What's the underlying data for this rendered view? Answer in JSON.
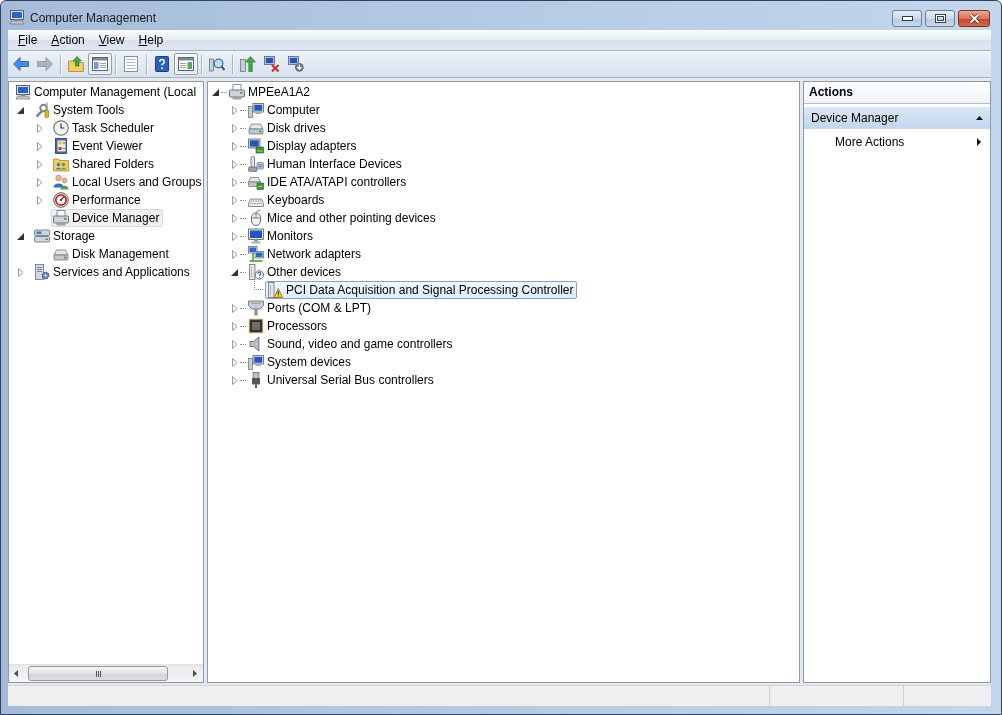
{
  "window": {
    "title": "Computer Management"
  },
  "menu_bar": [
    {
      "label": "File"
    },
    {
      "label": "Action"
    },
    {
      "label": "View"
    },
    {
      "label": "Help"
    }
  ],
  "toolbar": {
    "groups": [
      {
        "buttons": [
          {
            "pressed": false,
            "disabled": false
          },
          {
            "pressed": false,
            "disabled": true
          }
        ]
      },
      {
        "buttons": [
          {
            "pressed": false,
            "disabled": false
          },
          {
            "pressed": true,
            "disabled": false
          }
        ]
      },
      {
        "buttons": [
          {
            "pressed": false,
            "disabled": false
          }
        ]
      },
      {
        "buttons": [
          {
            "pressed": false,
            "disabled": false
          },
          {
            "pressed": true,
            "disabled": false
          }
        ]
      },
      {
        "buttons": [
          {
            "pressed": false,
            "disabled": false
          }
        ]
      },
      {
        "buttons": [
          {
            "pressed": false,
            "disabled": false
          },
          {
            "pressed": false,
            "disabled": false
          },
          {
            "pressed": false,
            "disabled": false
          }
        ]
      }
    ]
  },
  "console_tree": {
    "items": [
      {
        "label": "Computer Management (Local",
        "kind": "management",
        "expandable": false,
        "selected": false,
        "children": [
          {
            "label": "System Tools",
            "kind": "tools",
            "expandable": true,
            "expanded": true,
            "selected": false,
            "children": [
              {
                "label": "Task Scheduler",
                "kind": "clock",
                "expandable": true,
                "expanded": false,
                "selected": false
              },
              {
                "label": "Event Viewer",
                "kind": "log",
                "expandable": true,
                "expanded": false,
                "selected": false
              },
              {
                "label": "Shared Folders",
                "kind": "share",
                "expandable": true,
                "expanded": false,
                "selected": false
              },
              {
                "label": "Local Users and Groups",
                "kind": "users",
                "expandable": true,
                "expanded": false,
                "selected": false
              },
              {
                "label": "Performance",
                "kind": "performance",
                "expandable": true,
                "expanded": false,
                "selected": false
              },
              {
                "label": "Device Manager",
                "kind": "devices",
                "expandable": false,
                "selected": true
              }
            ]
          },
          {
            "label": "Storage",
            "kind": "storage",
            "expandable": true,
            "expanded": true,
            "selected": false,
            "children": [
              {
                "label": "Disk Management",
                "kind": "disk",
                "expandable": false,
                "selected": false
              }
            ]
          },
          {
            "label": "Services and Applications",
            "kind": "services",
            "expandable": true,
            "expanded": false,
            "selected": false
          }
        ]
      }
    ]
  },
  "device_tree": {
    "items": [
      {
        "label": "MPEeA1A2",
        "kind": "host",
        "expandable": true,
        "expanded": true,
        "selected": false,
        "children": [
          {
            "label": "Computer",
            "kind": "computer",
            "expandable": true,
            "expanded": false,
            "selected": false
          },
          {
            "label": "Disk drives",
            "kind": "disk",
            "expandable": true,
            "expanded": false,
            "selected": false
          },
          {
            "label": "Display adapters",
            "kind": "display",
            "expandable": true,
            "expanded": false,
            "selected": false
          },
          {
            "label": "Human Interface Devices",
            "kind": "hid",
            "expandable": true,
            "expanded": false,
            "selected": false
          },
          {
            "label": "IDE ATA/ATAPI controllers",
            "kind": "ide",
            "expandable": true,
            "expanded": false,
            "selected": false
          },
          {
            "label": "Keyboards",
            "kind": "keyboard",
            "expandable": true,
            "expanded": false,
            "selected": false
          },
          {
            "label": "Mice and other pointing devices",
            "kind": "mouse",
            "expandable": true,
            "expanded": false,
            "selected": false
          },
          {
            "label": "Monitors",
            "kind": "monitor",
            "expandable": true,
            "expanded": false,
            "selected": false
          },
          {
            "label": "Network adapters",
            "kind": "network",
            "expandable": true,
            "expanded": false,
            "selected": false
          },
          {
            "label": "Other devices",
            "kind": "unknown",
            "expandable": true,
            "expanded": true,
            "selected": false,
            "children": [
              {
                "label": "PCI Data Acquisition and Signal Processing Controller",
                "kind": "warning",
                "expandable": false,
                "selected": true
              }
            ]
          },
          {
            "label": "Ports (COM & LPT)",
            "kind": "port",
            "expandable": true,
            "expanded": false,
            "selected": false
          },
          {
            "label": "Processors",
            "kind": "processor",
            "expandable": true,
            "expanded": false,
            "selected": false
          },
          {
            "label": "Sound, video and game controllers",
            "kind": "sound",
            "expandable": true,
            "expanded": false,
            "selected": false
          },
          {
            "label": "System devices",
            "kind": "computer",
            "expandable": true,
            "expanded": false,
            "selected": false
          },
          {
            "label": "Universal Serial Bus controllers",
            "kind": "usb",
            "expandable": true,
            "expanded": false,
            "selected": false
          }
        ]
      }
    ]
  },
  "actions_pane": {
    "title": "Actions",
    "sections": [
      {
        "label": "Device Manager",
        "expanded": true,
        "items": [
          {
            "label": "More Actions",
            "submenu": true
          }
        ]
      }
    ]
  }
}
